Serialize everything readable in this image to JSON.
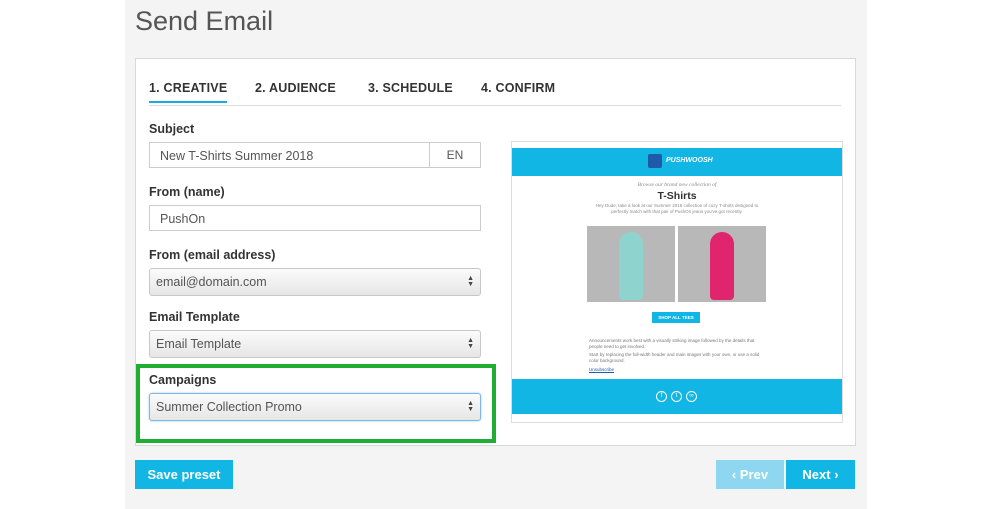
{
  "page_title": "Send Email",
  "tabs": [
    {
      "label": "1. CREATIVE"
    },
    {
      "label": "2. AUDIENCE"
    },
    {
      "label": "3. SCHEDULE"
    },
    {
      "label": "4. CONFIRM"
    }
  ],
  "form": {
    "subject_label": "Subject",
    "subject_value": "New T-Shirts Summer 2018",
    "language": "EN",
    "from_name_label": "From (name)",
    "from_name_value": "PushOn",
    "from_email_label": "From (email address)",
    "from_email_value": "email@domain.com",
    "template_label": "Email Template",
    "template_value": "Email Template",
    "campaigns_label": "Campaigns",
    "campaigns_value": "Summer Collection Promo"
  },
  "preview": {
    "brand": "PUSHWOOSH",
    "kicker": "Browse our brand new collection of",
    "product": "T-Shirts",
    "intro": "Hey Dude, take a look at our Summer 2018 collection of cozy T-shirts designed to perfectly match with that pair of PushOn jeans you've got recently.",
    "cta": "SHOP ALL TEES",
    "body1": "Announcements work best with a visually striking image followed by the details that people need to get involved.",
    "body2": "Start by replacing the full-width header and main images with your own, or use a solid color background.",
    "unsubscribe": "Unsubscribe"
  },
  "buttons": {
    "save_preset": "Save preset",
    "prev": "Prev",
    "next": "Next"
  },
  "colors": {
    "accent": "#12b6e4",
    "highlight": "#1fae33"
  }
}
